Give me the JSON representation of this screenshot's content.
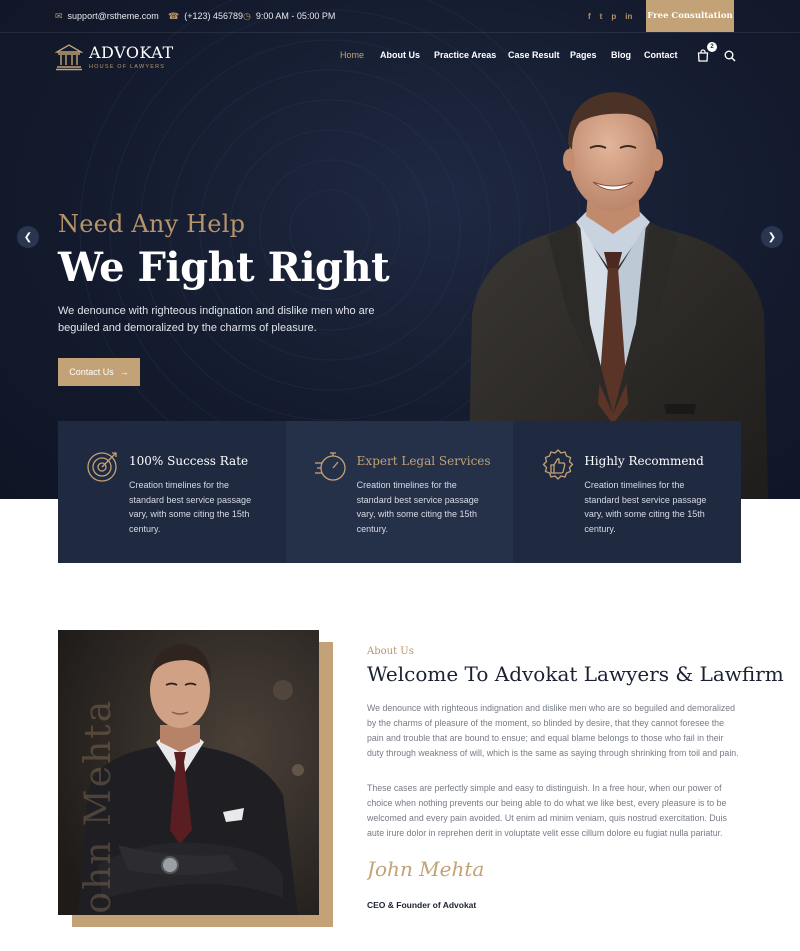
{
  "topbar": {
    "email": "support@rstheme.com",
    "phone": "(+123) 456789",
    "hours": "9:00 AM - 05:00 PM",
    "social": [
      "f",
      "t",
      "p",
      "in"
    ],
    "consult_label": "Free Consultation"
  },
  "brand": {
    "name": "ADVOKAT",
    "tagline": "HOUSE OF LAWYERS"
  },
  "nav": {
    "items": [
      "Home",
      "About Us",
      "Practice Areas",
      "Case Result",
      "Pages",
      "Blog",
      "Contact"
    ],
    "active": "Home",
    "cart_count": "2"
  },
  "hero": {
    "kicker": "Need Any Help",
    "title": "We Fight Right",
    "text": "We denounce with righteous indignation and dislike men who are beguiled and demoralized by the charms of pleasure.",
    "cta": "Contact Us"
  },
  "features": [
    {
      "title": "100% Success Rate",
      "text": "Creation timelines for the standard best service passage vary, with some citing the 15th century.",
      "icon": "target-icon"
    },
    {
      "title": "Expert Legal Services",
      "text": "Creation timelines for the standard best service passage vary, with some citing the 15th century.",
      "icon": "stopwatch-icon"
    },
    {
      "title": "Highly Recommend",
      "text": "Creation timelines for the standard best service passage vary, with some citing the 15th century.",
      "icon": "thumbs-up-icon"
    }
  ],
  "about": {
    "kicker": "About Us",
    "title": "Welcome To Advokat Lawyers & Lawfirm",
    "para1": "We denounce with righteous indignation and dislike men who are so beguiled and demoralized by the charms of pleasure of the moment, so blinded by desire, that they cannot foresee the pain and trouble that are bound to ensue; and equal blame belongs to those who fail in their duty through weakness of will, which is the same as saying through shrinking from toil and pain.",
    "para2": "These cases are perfectly simple and easy to distinguish. In a free hour, when our power of choice when nothing prevents our being able to do what we like best, every pleasure is to be welcomed and every pain avoided. Ut enim ad minim veniam, quis nostrud exercitation. Duis aute irure dolor in reprehen derit in voluptate velit esse cillum dolore eu fugiat nulla pariatur.",
    "vertical_name": "John Mehta",
    "signature": "John Mehta",
    "role": "CEO & Founder of Advokat"
  },
  "colors": {
    "accent": "#c2a276",
    "navy": "#1f2940",
    "hero_bg": "#141b2e"
  }
}
